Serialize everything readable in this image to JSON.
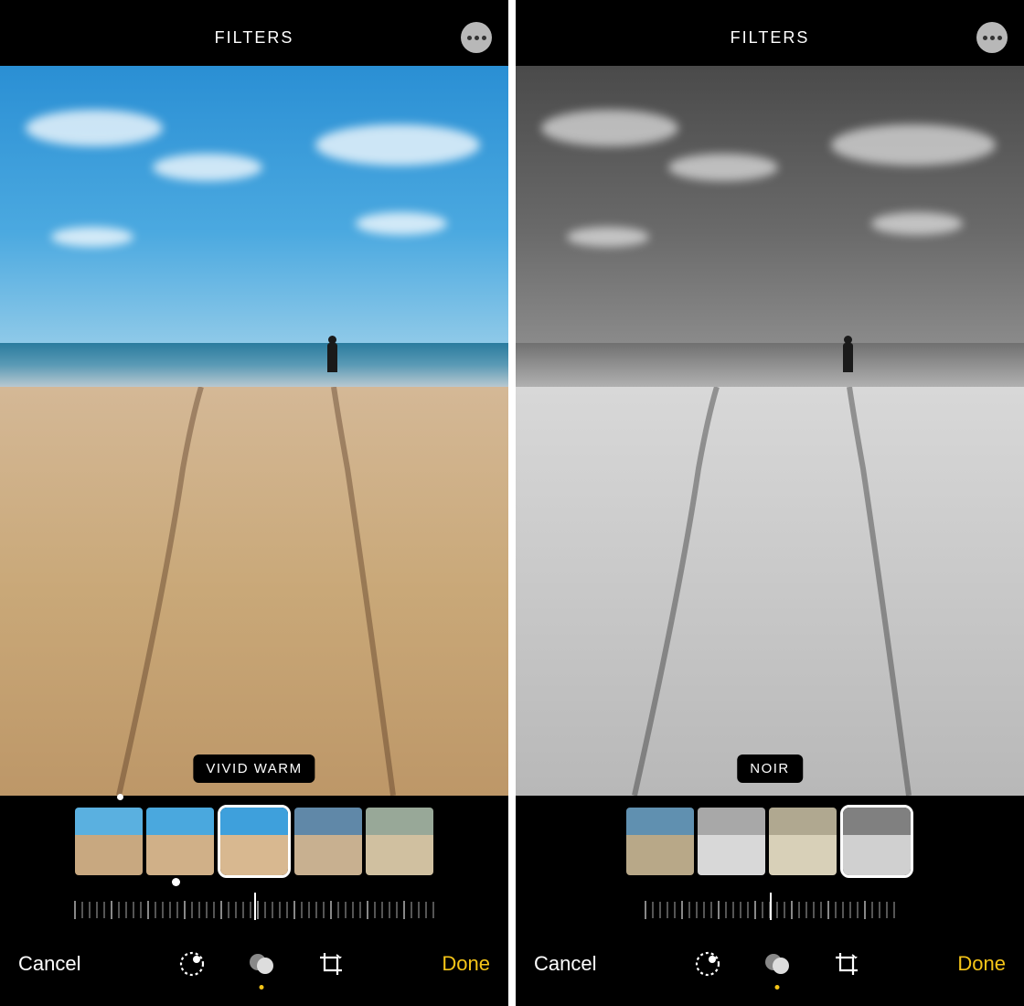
{
  "screens": [
    {
      "header": {
        "title": "FILTERS"
      },
      "filter_badge": "VIVID WARM",
      "bottom": {
        "cancel": "Cancel",
        "done": "Done"
      }
    },
    {
      "header": {
        "title": "FILTERS"
      },
      "filter_badge": "NOIR",
      "bottom": {
        "cancel": "Cancel",
        "done": "Done"
      }
    }
  ],
  "filter_thumbs_left_count": 5,
  "filter_thumbs_right_count": 4,
  "tools": [
    "adjust",
    "filters",
    "crop"
  ],
  "active_tool": "filters",
  "colors": {
    "accent": "#f5c518",
    "badge_bg": "#000000",
    "badge_fg": "#ffffff"
  }
}
